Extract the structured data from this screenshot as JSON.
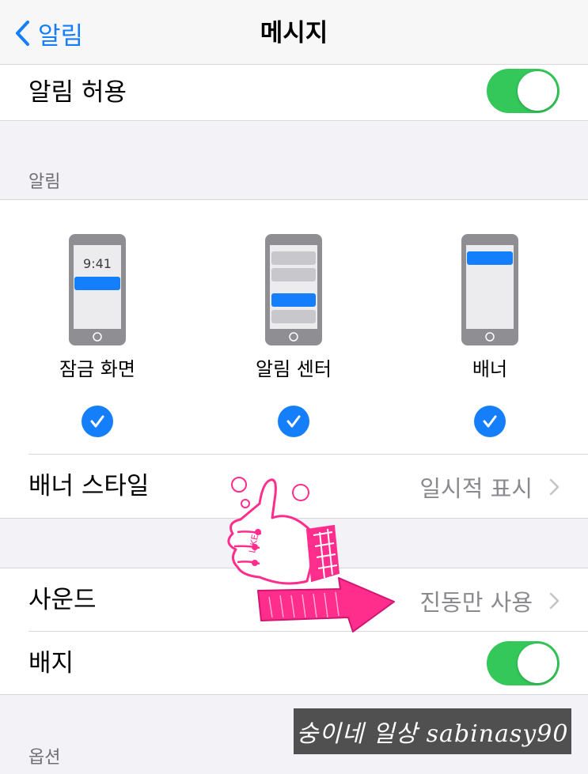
{
  "nav": {
    "back_label": "알림",
    "title": "메시지"
  },
  "allow_notifications": {
    "label": "알림 허용",
    "enabled": true
  },
  "alerts": {
    "header": "알림",
    "styles": [
      {
        "label": "잠금 화면",
        "checked": true,
        "clock": "9:41"
      },
      {
        "label": "알림 센터",
        "checked": true
      },
      {
        "label": "배너",
        "checked": true
      }
    ]
  },
  "banner_style": {
    "label": "배너 스타일",
    "value": "일시적 표시"
  },
  "sounds": {
    "label": "사운드",
    "value": "진동만 사용"
  },
  "badges": {
    "label": "배지",
    "enabled": true
  },
  "options_header": "옵션",
  "sticker": {
    "text": "LIKE"
  },
  "watermark": "숭이네 일상 sabinasy90",
  "colors": {
    "accent": "#147efb",
    "toggle_on": "#34c759",
    "background": "#f2f2f7",
    "sticker_pink": "#ff2d8c"
  }
}
